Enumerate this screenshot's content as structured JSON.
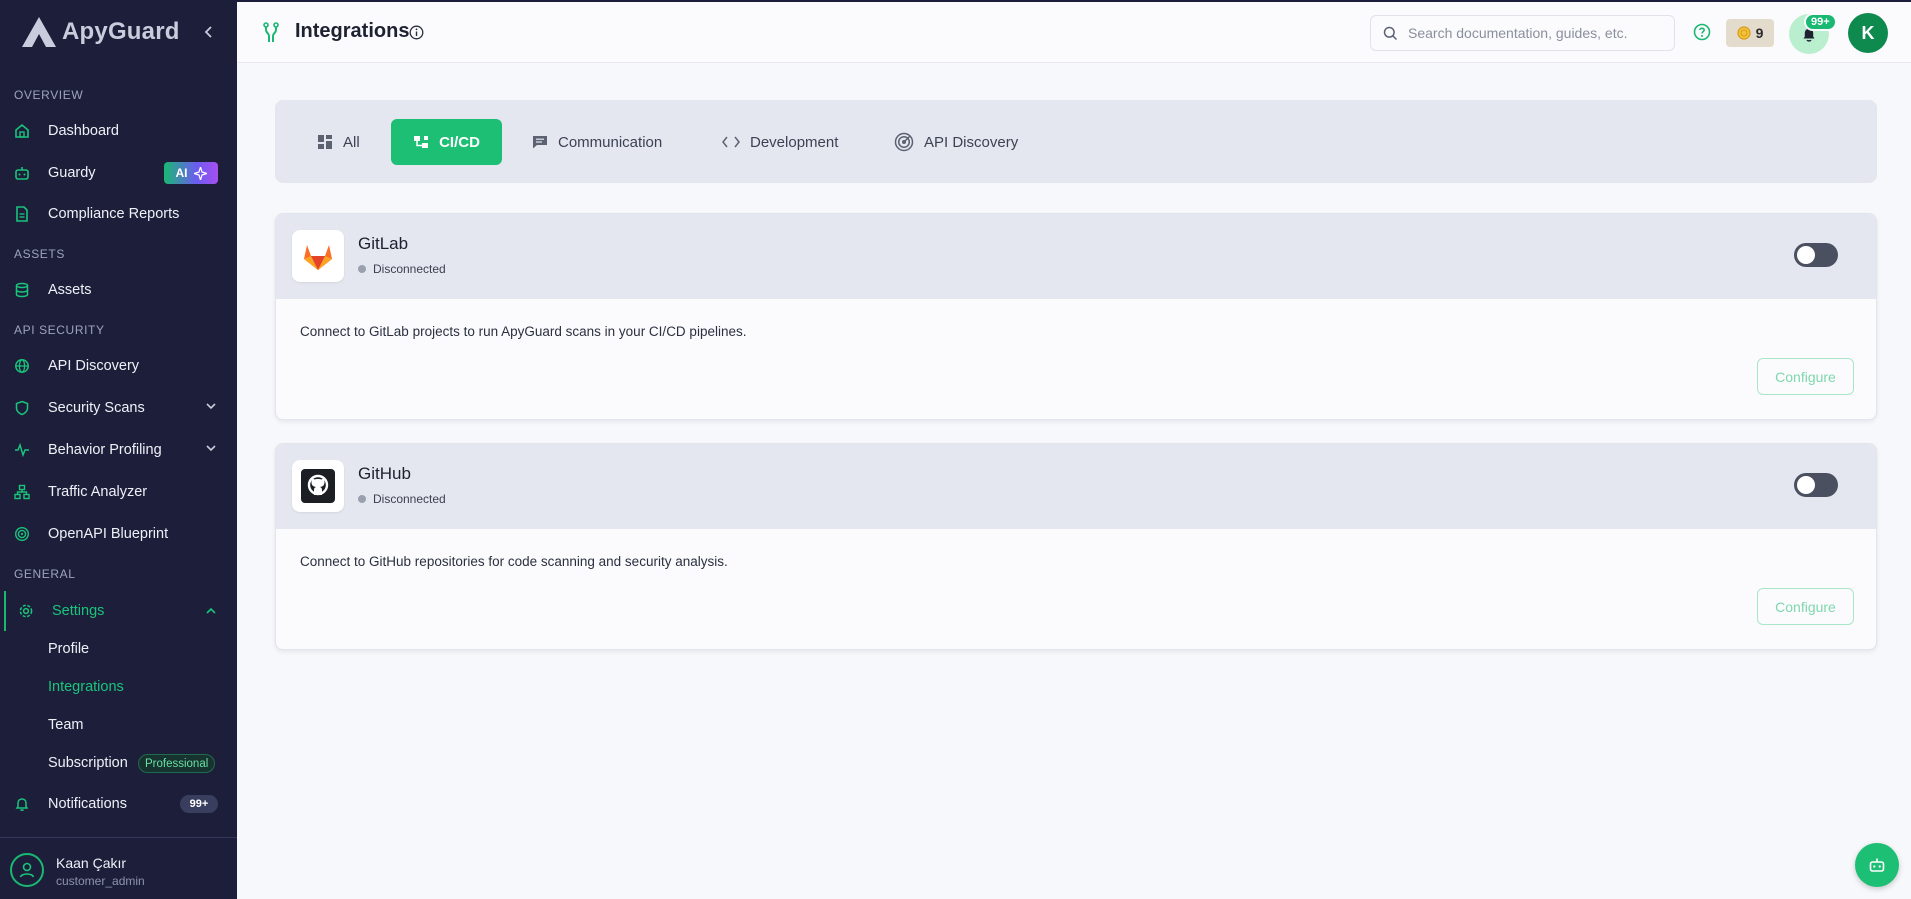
{
  "app": {
    "brand": "ApyGuard"
  },
  "sidebar": {
    "sections": {
      "overview": "OVERVIEW",
      "assets": "ASSETS",
      "api_security": "API SECURITY",
      "general": "GENERAL"
    },
    "items": {
      "dashboard": "Dashboard",
      "guardy": "Guardy",
      "guardy_badge": "AI",
      "compliance": "Compliance Reports",
      "assets": "Assets",
      "api_discovery": "API Discovery",
      "security_scans": "Security Scans",
      "behavior_profiling": "Behavior Profiling",
      "traffic_analyzer": "Traffic Analyzer",
      "openapi_blueprint": "OpenAPI Blueprint",
      "settings": "Settings",
      "profile": "Profile",
      "integrations": "Integrations",
      "team": "Team",
      "subscription": "Subscription",
      "subscription_badge": "Professional",
      "notifications": "Notifications",
      "notifications_count": "99+"
    },
    "user": {
      "name": "Kaan Çakır",
      "role": "customer_admin"
    }
  },
  "header": {
    "title": "Integrations",
    "search_placeholder": "Search documentation, guides, etc.",
    "credits": "9",
    "notifications_badge": "99+",
    "avatar_initial": "K"
  },
  "tabs": [
    {
      "label": "All",
      "icon": "grid-icon",
      "active": false
    },
    {
      "label": "CI/CD",
      "icon": "pipeline-icon",
      "active": true
    },
    {
      "label": "Communication",
      "icon": "chat-icon",
      "active": false
    },
    {
      "label": "Development",
      "icon": "code-icon",
      "active": false
    },
    {
      "label": "API Discovery",
      "icon": "radar-icon",
      "active": false
    }
  ],
  "integrations": [
    {
      "name": "GitLab",
      "status": "Disconnected",
      "description": "Connect to GitLab projects to run ApyGuard scans in your CI/CD pipelines.",
      "button": "Configure",
      "enabled": false
    },
    {
      "name": "GitHub",
      "status": "Disconnected",
      "description": "Connect to GitHub repositories for code scanning and security analysis.",
      "button": "Configure",
      "enabled": false
    }
  ],
  "colors": {
    "accent": "#1cbf74",
    "sidebar_bg": "#1d1f3a"
  }
}
